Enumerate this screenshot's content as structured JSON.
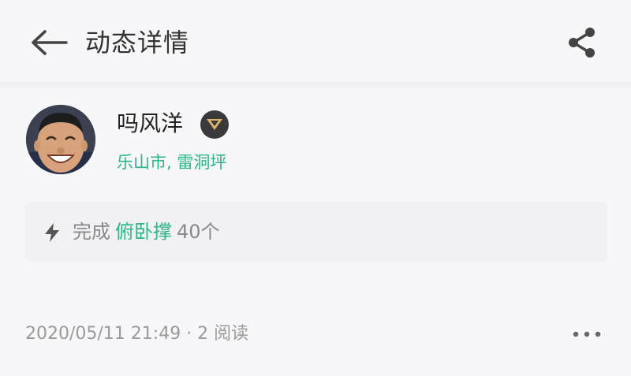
{
  "header": {
    "title": "动态详情",
    "back_icon": "arrow-left-icon",
    "share_icon": "share-icon"
  },
  "user": {
    "name": "吗风洋",
    "badge_icon": "chevron-down-badge-icon",
    "location": "乐山市, 雷洞坪"
  },
  "activity": {
    "icon": "bolt-icon",
    "prefix": "完成",
    "name": "俯卧撑",
    "count": "40个"
  },
  "meta": {
    "datetime_reads": "2020/05/11 21:49 · 2 阅读",
    "more_icon": "more-horizontal-icon"
  },
  "colors": {
    "accent": "#2bb58a",
    "background": "#f7f7f9",
    "card": "#f1f1f4",
    "secondary_text": "#9a9a9a"
  }
}
